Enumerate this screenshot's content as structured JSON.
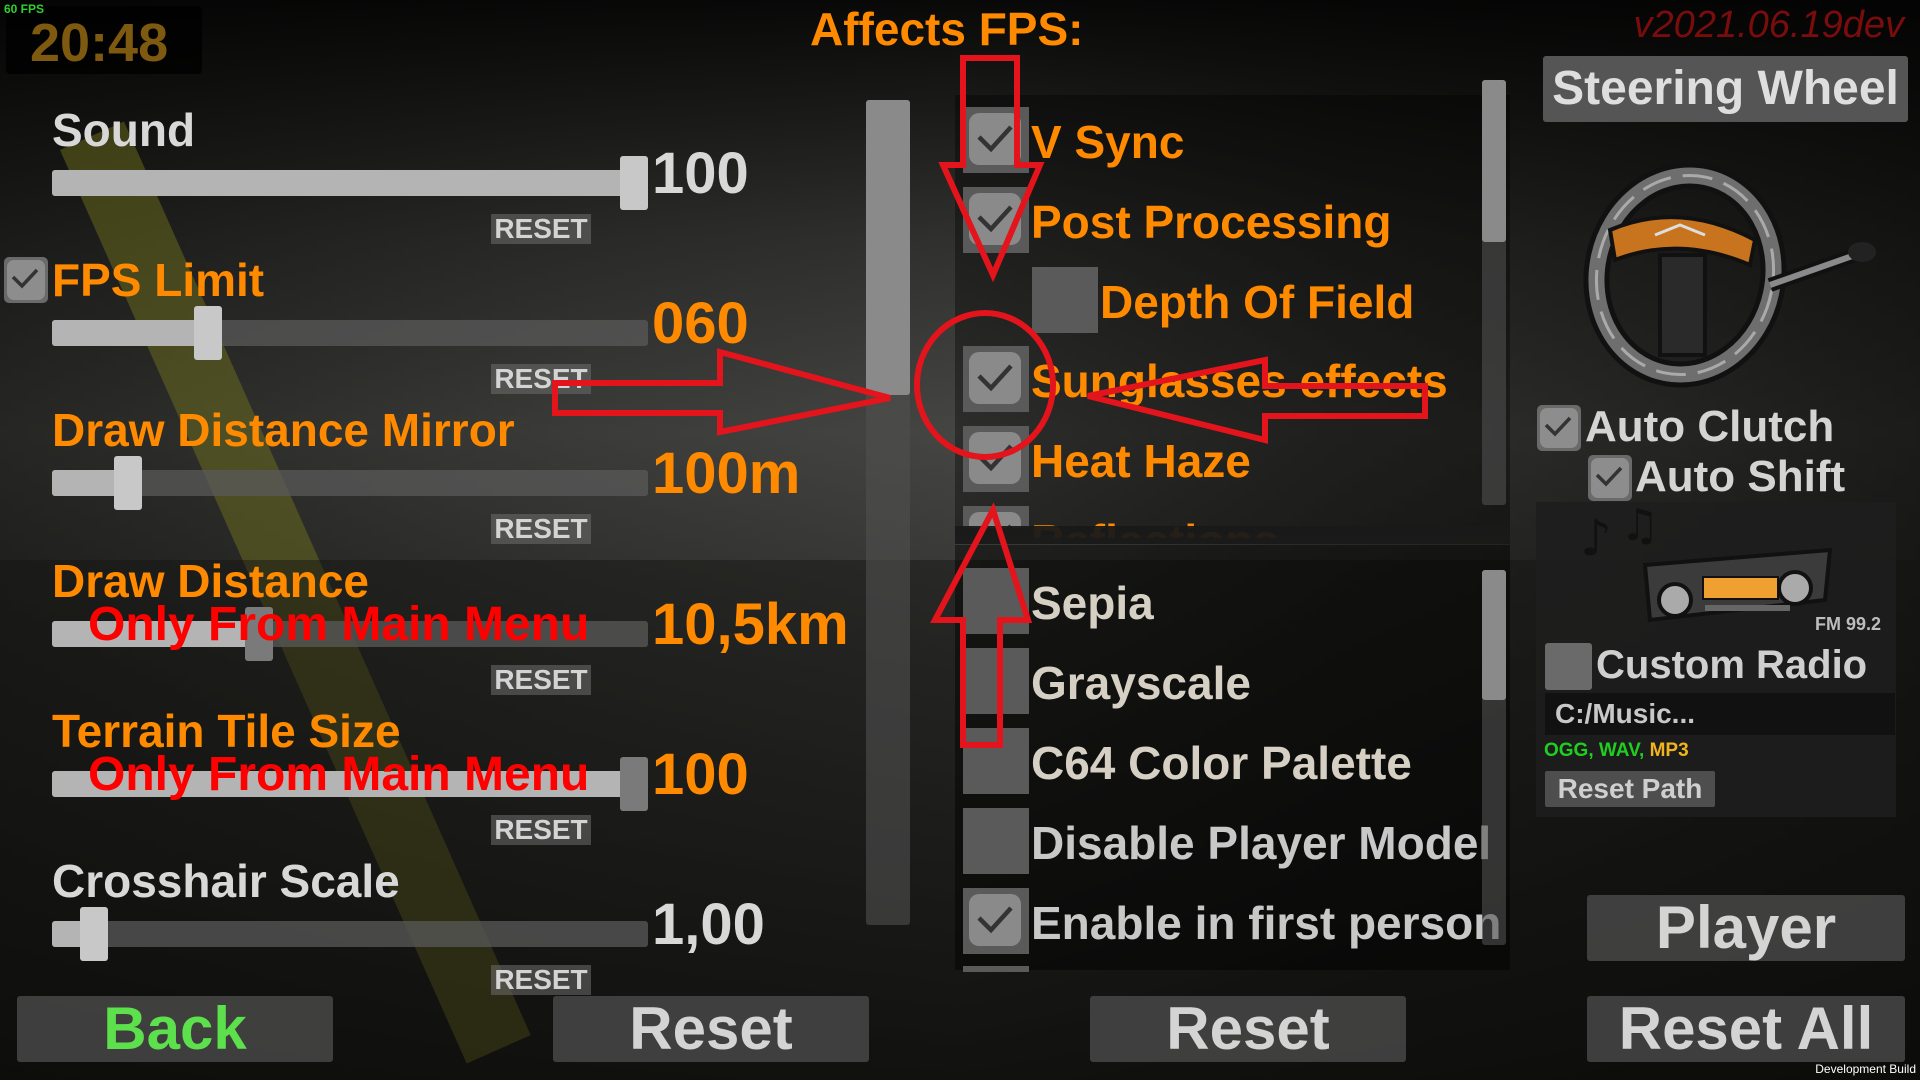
{
  "hud": {
    "fps_counter": "60 FPS",
    "clock": "20:48",
    "version": "v2021.06.19dev",
    "dev_build": "Development Build"
  },
  "annotation": {
    "affects_fps": "Affects FPS:",
    "color": "#e3141b"
  },
  "left_settings": [
    {
      "label": "Sound",
      "value": "100",
      "fraction": 1.0,
      "reset": "RESET",
      "color": "white",
      "note": null,
      "enabled": true
    },
    {
      "label": "FPS Limit",
      "value": "060",
      "fraction": 0.25,
      "reset": "RESET",
      "color": "orange",
      "note": null,
      "enabled": true,
      "checkbox": true
    },
    {
      "label": "Draw Distance Mirror",
      "value": "100m",
      "fraction": 0.11,
      "reset": "RESET",
      "color": "orange",
      "note": null,
      "enabled": true
    },
    {
      "label": "Draw Distance",
      "value": "10,5km",
      "fraction": 0.34,
      "reset": "RESET",
      "color": "orange",
      "note": "Only From Main Menu",
      "enabled": false
    },
    {
      "label": "Terrain Tile Size",
      "value": "100",
      "fraction": 1.0,
      "reset": "RESET",
      "color": "orange",
      "note": "Only From Main Menu",
      "enabled": false
    },
    {
      "label": "Crosshair Scale",
      "value": "1,00",
      "fraction": 0.05,
      "reset": "RESET",
      "color": "white",
      "note": null,
      "enabled": true
    }
  ],
  "graphics_options": [
    {
      "label": "V Sync",
      "checked": true,
      "color": "orange",
      "indent": false
    },
    {
      "label": "Post Processing",
      "checked": true,
      "color": "orange",
      "indent": false
    },
    {
      "label": "Depth Of Field",
      "checked": false,
      "color": "orange",
      "indent": true
    },
    {
      "label": "Sunglasses effects",
      "checked": true,
      "color": "orange",
      "indent": false
    },
    {
      "label": "Heat Haze",
      "checked": true,
      "color": "orange",
      "indent": false
    },
    {
      "label": "Reflections",
      "checked": true,
      "color": "orange",
      "indent": false
    }
  ],
  "filter_options": [
    {
      "label": "Sepia",
      "checked": false,
      "color": "beige"
    },
    {
      "label": "Grayscale",
      "checked": false,
      "color": "beige"
    },
    {
      "label": "C64 Color Palette",
      "checked": false,
      "color": "beige"
    },
    {
      "label": "Disable Player Model",
      "checked": false,
      "color": "grey"
    },
    {
      "label": "Enable in first person",
      "checked": true,
      "color": "grey"
    }
  ],
  "scrollbars": {
    "settings_scroll_position": 0.0,
    "graphics_scroll_position": 0.0,
    "filters_scroll_position": 0.0
  },
  "vehicle": {
    "steering_wheel_button": "Steering Wheel",
    "auto_clutch": {
      "label": "Auto Clutch",
      "checked": true
    },
    "auto_shift": {
      "label": "Auto Shift",
      "checked": true
    }
  },
  "radio": {
    "station": "FM 99.2",
    "custom_radio": {
      "label": "Custom Radio",
      "checked": false
    },
    "path": "C:/Music...",
    "formats": [
      {
        "text": "OGG,",
        "color": "#1fcf1f"
      },
      {
        "text": "WAV,",
        "color": "#1fcf1f"
      },
      {
        "text": "MP3",
        "color": "#f2b41c"
      }
    ],
    "reset_path": "Reset Path"
  },
  "buttons": {
    "back": "Back",
    "reset_left": "Reset",
    "reset_mid": "Reset",
    "player": "Player",
    "reset_all": "Reset All"
  }
}
